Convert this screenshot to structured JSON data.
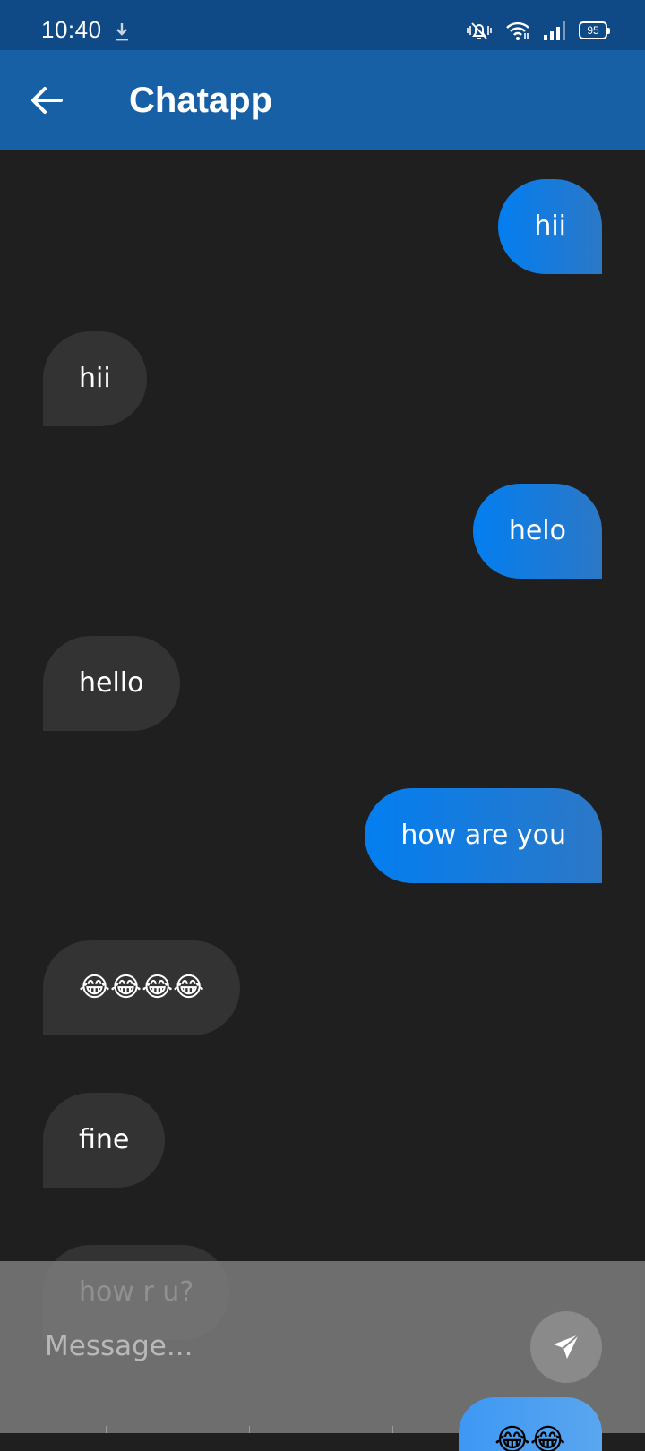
{
  "status_bar": {
    "time": "10:40",
    "icons": [
      "download-icon",
      "mute-icon",
      "wifi-icon",
      "signal-icon",
      "battery-icon"
    ],
    "battery": "95"
  },
  "app_bar": {
    "title": "Chatapp",
    "back_icon": "arrow-left-icon",
    "background": "#1760a5"
  },
  "messages": [
    {
      "text": "hii",
      "direction": "sent"
    },
    {
      "text": "hii",
      "direction": "received"
    },
    {
      "text": "helo",
      "direction": "sent"
    },
    {
      "text": "hello",
      "direction": "received"
    },
    {
      "text": "how are you",
      "direction": "sent"
    },
    {
      "text": "😂😂😂😂",
      "direction": "received"
    },
    {
      "text": "fine",
      "direction": "received"
    },
    {
      "text": "how r u?",
      "direction": "received"
    },
    {
      "text": "😂😂",
      "direction": "sent"
    }
  ],
  "composer": {
    "placeholder": "Message...",
    "value": "",
    "send_icon": "send-icon"
  },
  "colors": {
    "chat_background": "#1f1f1f",
    "sent_bubble": "#037ef0",
    "received_bubble": "#333333"
  }
}
